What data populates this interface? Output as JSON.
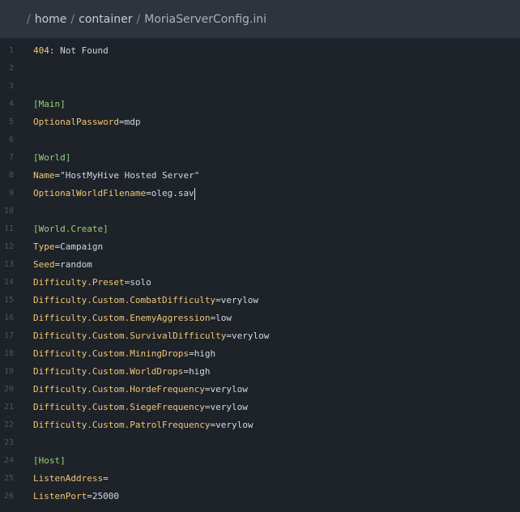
{
  "breadcrumb": {
    "sep": "/",
    "segments": [
      "home",
      "container"
    ],
    "file": "MoriaServerConfig.ini"
  },
  "editor": {
    "lines": [
      {
        "num": "1",
        "key": "404",
        "val": ": Not Found",
        "type": "kv_status"
      },
      {
        "num": "2",
        "type": "empty"
      },
      {
        "num": "3",
        "type": "empty"
      },
      {
        "num": "4",
        "section": "[Main]",
        "type": "section"
      },
      {
        "num": "5",
        "key": "OptionalPassword",
        "val": "mdp",
        "type": "kv"
      },
      {
        "num": "6",
        "type": "empty"
      },
      {
        "num": "7",
        "section": "[World]",
        "type": "section"
      },
      {
        "num": "8",
        "key": "Name",
        "val": "\"HostMyHive Hosted Server\"",
        "type": "kv"
      },
      {
        "num": "9",
        "key": "OptionalWorldFilename",
        "val": "oleg.sav",
        "type": "kv",
        "cursor": true
      },
      {
        "num": "10",
        "type": "empty"
      },
      {
        "num": "11",
        "section": "[World.Create]",
        "type": "section"
      },
      {
        "num": "12",
        "key": "Type",
        "val": "Campaign",
        "type": "kv"
      },
      {
        "num": "13",
        "key": "Seed",
        "val": "random",
        "type": "kv"
      },
      {
        "num": "14",
        "key": "Difficulty.Preset",
        "val": "solo",
        "type": "kv"
      },
      {
        "num": "15",
        "key": "Difficulty.Custom.CombatDifficulty",
        "val": "verylow",
        "type": "kv"
      },
      {
        "num": "16",
        "key": "Difficulty.Custom.EnemyAggression",
        "val": "low",
        "type": "kv"
      },
      {
        "num": "17",
        "key": "Difficulty.Custom.SurvivalDifficulty",
        "val": "verylow",
        "type": "kv"
      },
      {
        "num": "18",
        "key": "Difficulty.Custom.MiningDrops",
        "val": "high",
        "type": "kv"
      },
      {
        "num": "19",
        "key": "Difficulty.Custom.WorldDrops",
        "val": "high",
        "type": "kv"
      },
      {
        "num": "20",
        "key": "Difficulty.Custom.HordeFrequency",
        "val": "verylow",
        "type": "kv"
      },
      {
        "num": "21",
        "key": "Difficulty.Custom.SiegeFrequency",
        "val": "verylow",
        "type": "kv"
      },
      {
        "num": "22",
        "key": "Difficulty.Custom.PatrolFrequency",
        "val": "verylow",
        "type": "kv"
      },
      {
        "num": "23",
        "type": "empty"
      },
      {
        "num": "24",
        "section": "[Host]",
        "type": "section"
      },
      {
        "num": "25",
        "key": "ListenAddress",
        "val": "",
        "type": "kv"
      },
      {
        "num": "26",
        "key": "ListenPort",
        "val": "25000",
        "type": "kv"
      }
    ]
  },
  "colors": {
    "background": "#1e2229",
    "header": "#2e343d",
    "key": "#f1c773",
    "section": "#98cf7a",
    "text": "#d4d8de"
  }
}
